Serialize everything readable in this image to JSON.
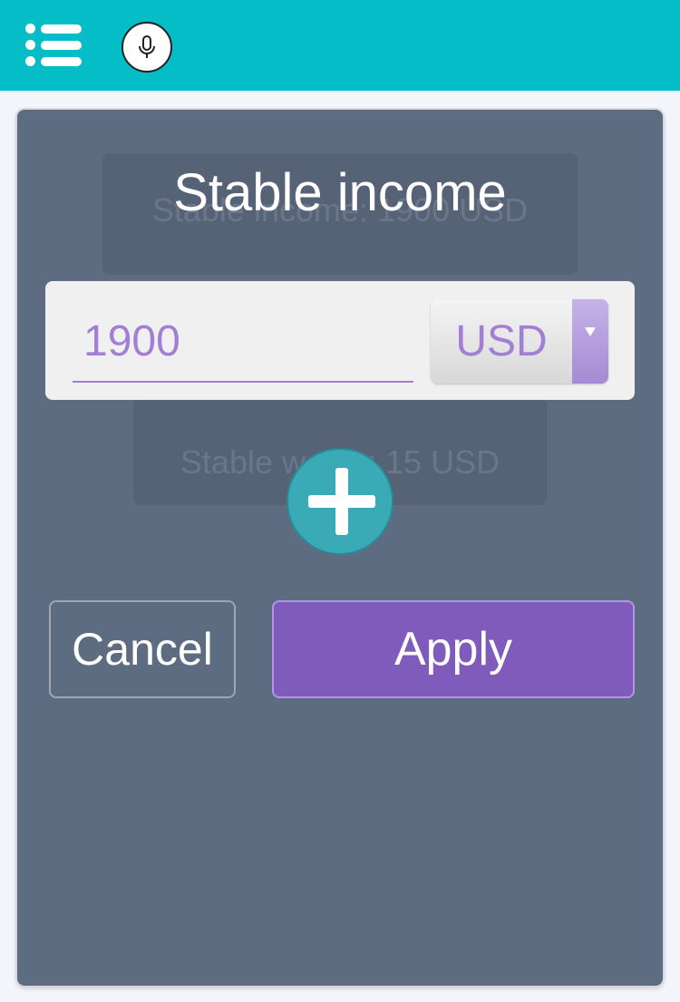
{
  "header": {
    "menu_icon": "list-menu-icon",
    "mic_icon": "microphone-icon",
    "accent_color": "#04bdc6"
  },
  "dialog": {
    "title": "Stable income",
    "amount_value": "1900",
    "currency": {
      "selected": "USD",
      "icon": "chevron-down-icon"
    },
    "add_icon": "plus-icon",
    "cancel_label": "Cancel",
    "apply_label": "Apply",
    "apply_color": "#7f5bbb"
  },
  "background_cards": [
    {
      "text": "Stable income: 1900 USD"
    },
    {
      "text": "Stable waste: 15 USD"
    }
  ]
}
